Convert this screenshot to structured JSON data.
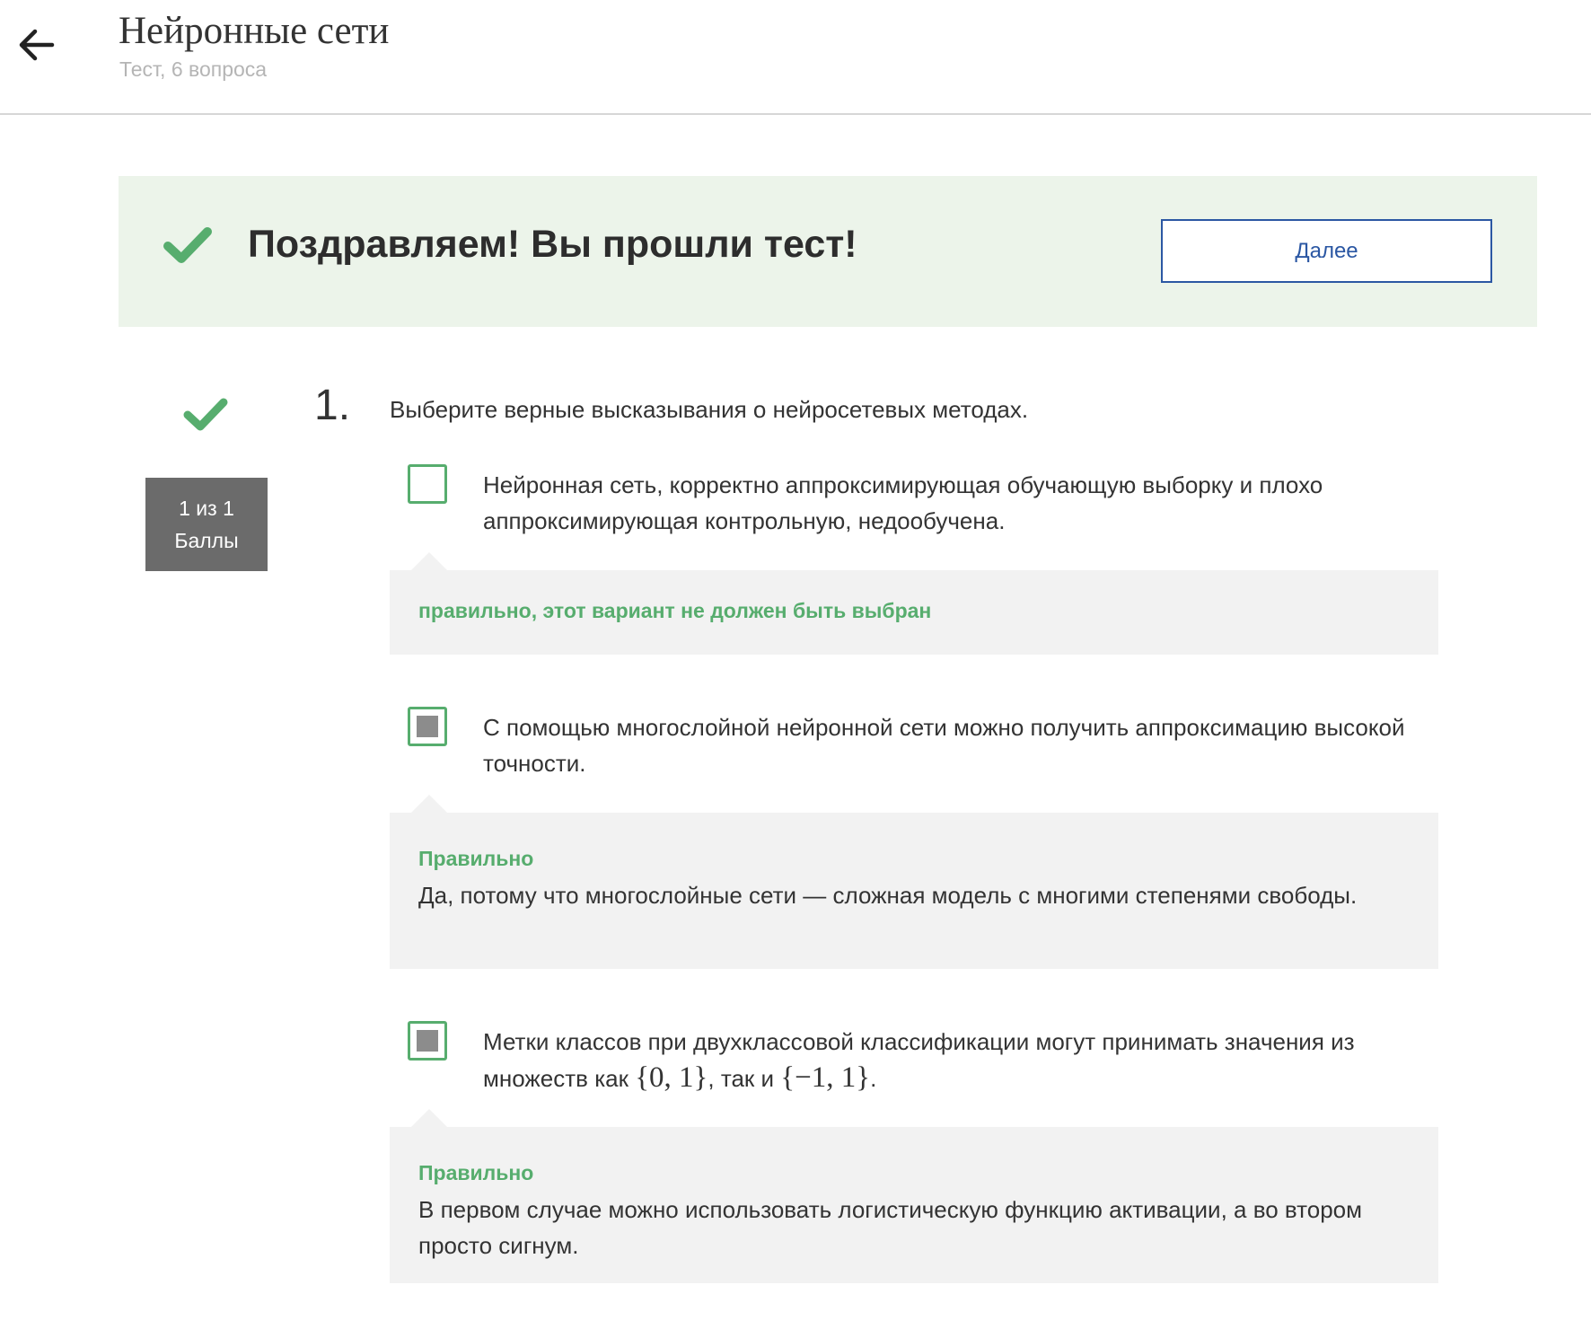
{
  "header": {
    "title": "Нейронные сети",
    "subtitle": "Тест, 6 вопроса",
    "back_icon": "arrow-left-icon"
  },
  "banner": {
    "message": "Поздравляем! Вы прошли тест!",
    "next_label": "Далее",
    "status_icon": "check-icon"
  },
  "colors": {
    "success_green": "#57ad6e",
    "banner_bg": "#ecf4ea",
    "link_blue": "#2b57a3",
    "score_bg": "#6b6b6b",
    "feedback_bg": "#f2f2f2"
  },
  "question": {
    "number": "1.",
    "text": "Выберите верные высказывания о нейросетевых методах.",
    "score_line1": "1 из 1",
    "score_line2": "Баллы",
    "options": [
      {
        "text": "Нейронная сеть, корректно аппроксимирующая обучающую выборку и плохо аппроксимирующая контрольную, недообучена.",
        "checked": false,
        "feedback_title": "правильно, этот вариант не должен быть выбран",
        "feedback_text": ""
      },
      {
        "text": "С помощью многослойной нейронной сети можно получить аппроксимацию высокой точности.",
        "checked": true,
        "feedback_title": "Правильно",
        "feedback_text": "Да, потому что многослойные сети — сложная модель с многими степенями свободы."
      },
      {
        "text_part1": "Метки классов при двухклассовой классификации могут принимать значения из множеств как ",
        "math1": "{0, 1}",
        "text_part2": ", так и ",
        "math2": "{−1, 1}",
        "text_part3": ".",
        "checked": true,
        "feedback_title": "Правильно",
        "feedback_text": "В первом случае можно использовать логистическую функцию активации, а во втором просто сигнум."
      }
    ]
  }
}
